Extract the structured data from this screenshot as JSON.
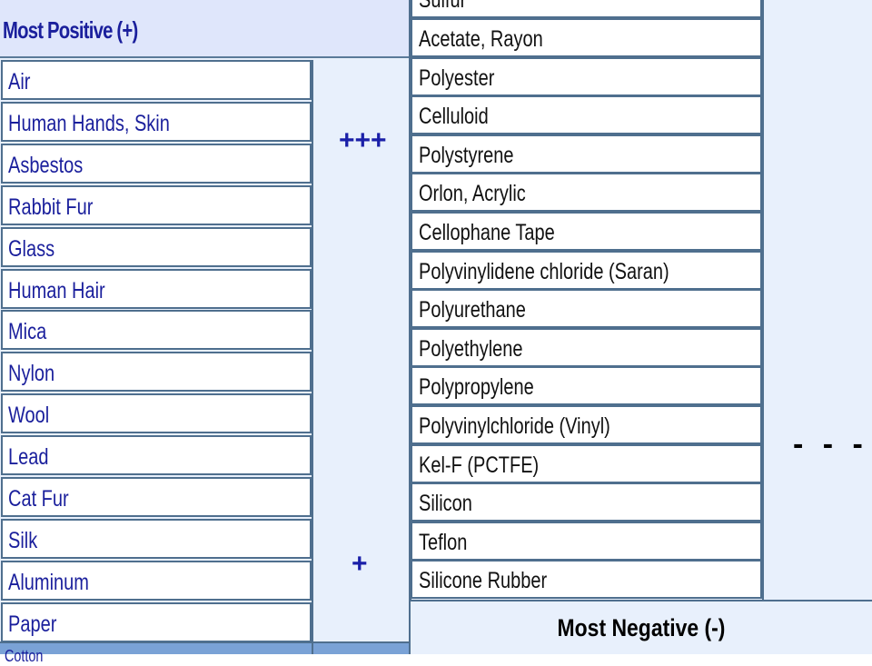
{
  "positive_table": {
    "header": "Most Positive (+)",
    "items": [
      "Air",
      "Human Hands, Skin",
      "Asbestos",
      "Rabbit Fur",
      "Glass",
      "Human Hair",
      "Mica",
      "Nylon",
      "Wool",
      "Lead",
      "Cat Fur",
      "Silk",
      "Aluminum",
      "Paper"
    ],
    "strong_sign": "+++",
    "weak_sign": "+",
    "cut_off_next_item": "Cotton"
  },
  "negative_table": {
    "cut_off_first_item": "Sulfur",
    "items": [
      "Acetate, Rayon",
      "Polyester",
      "Celluloid",
      "Polystyrene",
      "Orlon, Acrylic",
      "Cellophane Tape",
      "Polyvinylidene chloride (Saran)",
      "Polyurethane",
      "Polyethylene",
      "Polypropylene",
      "Polyvinylchloride (Vinyl)",
      "Kel-F (PCTFE)",
      "Silicon",
      "Teflon",
      "Silicone Rubber"
    ],
    "strong_sign": "- - -",
    "footer": "Most Negative (-)"
  },
  "colors": {
    "text_blue": "#1a1f9c",
    "cell_bg": "#e8f0fc",
    "border": "#4f6f8e",
    "bottom_bar": "#7aa2d6"
  }
}
